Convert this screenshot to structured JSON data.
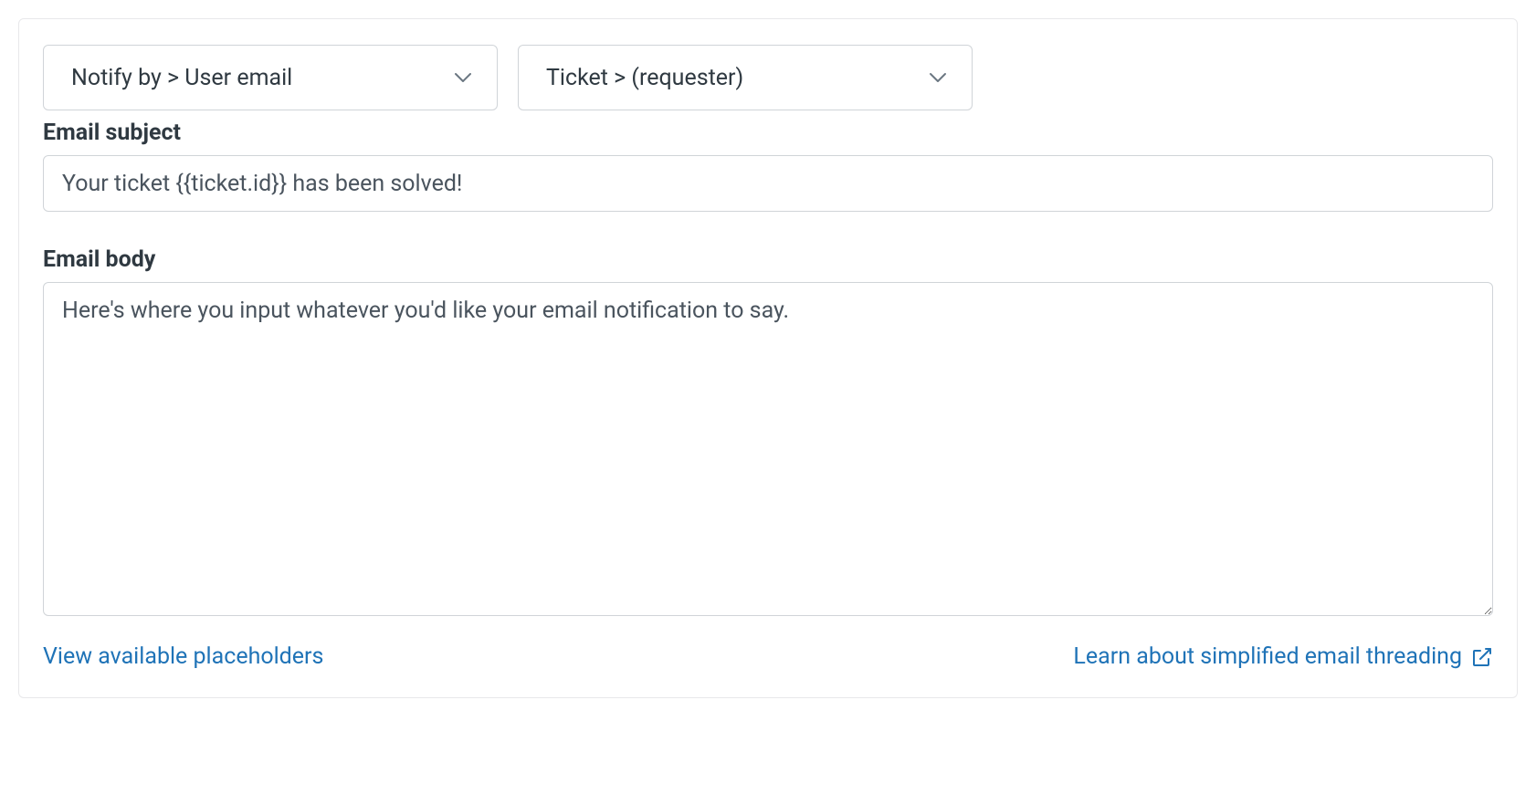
{
  "action": {
    "notify_by": "Notify by > User email",
    "recipient": "Ticket > (requester)"
  },
  "subject": {
    "label": "Email subject",
    "value": "Your ticket {{ticket.id}} has been solved!"
  },
  "body": {
    "label": "Email body",
    "value": "Here's where you input whatever you'd like your email notification to say."
  },
  "links": {
    "placeholders": "View available placeholders",
    "threading": "Learn about simplified email threading"
  }
}
